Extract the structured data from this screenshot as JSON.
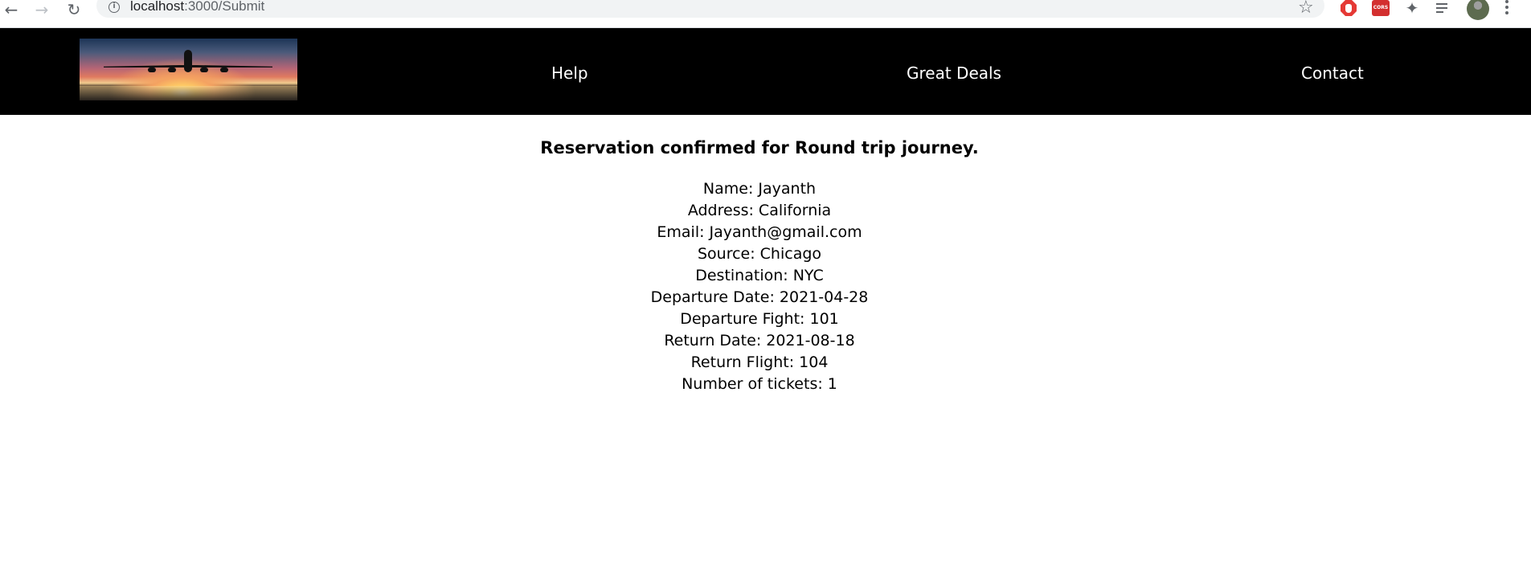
{
  "browser": {
    "url_host": "localhost",
    "url_path": ":3000/Submit",
    "extensions": {
      "cors_label": "CORS"
    },
    "icons": [
      "back-arrow-icon",
      "forward-arrow-icon",
      "reload-icon",
      "info-icon",
      "star-icon",
      "adblock-icon",
      "cors-icon",
      "puzzle-icon",
      "media-control-icon",
      "avatar",
      "kebab-menu-icon"
    ]
  },
  "header": {
    "logo_alt": "airplane at sunset logo",
    "nav": {
      "help": "Help",
      "deals": "Great Deals",
      "contact": "Contact"
    },
    "background": "#000000",
    "text_color": "#ffffff"
  },
  "confirmation": {
    "heading": "Reservation confirmed for Round trip journey.",
    "details": [
      "Name: Jayanth",
      "Address: California",
      "Email: Jayanth@gmail.com",
      "Source: Chicago",
      "Destination: NYC",
      "Departure Date: 2021-04-28",
      "Departure Fight: 101",
      "Return Date: 2021-08-18",
      "Return Flight: 104",
      "Number of tickets: 1"
    ]
  }
}
